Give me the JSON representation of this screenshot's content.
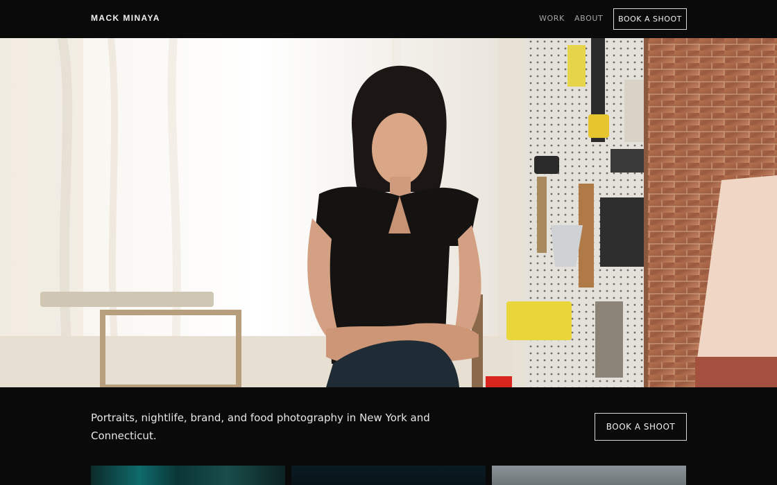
{
  "header": {
    "brand": "MACK MINAYA",
    "nav": [
      {
        "label": "WORK"
      },
      {
        "label": "ABOUT"
      }
    ],
    "cta": "BOOK A SHOOT"
  },
  "hero": {
    "alt": "Portrait of a woman seated in a sunlit workshop with tools on a pegboard"
  },
  "intro": {
    "text": "Portraits, nightlife, brand, and food photography in New York and Connecticut.",
    "cta": "BOOK A SHOOT"
  },
  "gallery": {
    "thumbs": [
      "thumb-1",
      "thumb-2",
      "thumb-3"
    ]
  },
  "colors": {
    "background": "#0a0a0a",
    "text": "#e8e8e8",
    "muted": "#a6a6a6"
  }
}
